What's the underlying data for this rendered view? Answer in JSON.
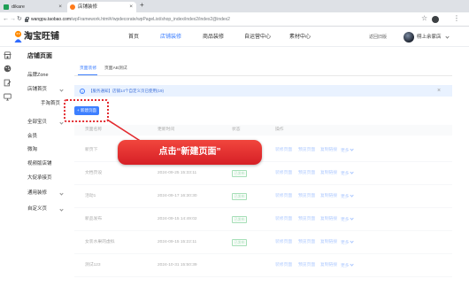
{
  "browser": {
    "tabs": [
      {
        "label": "dikare"
      },
      {
        "label": "店铺装修"
      }
    ],
    "url_domain": "wangpu.taobao.com",
    "url_path": "/wpFramework.html#/wpdecorate/wpPageList/shop_index/index2/index2@index2"
  },
  "header": {
    "logo_text": "淘宝旺铺",
    "nav": [
      {
        "label": "首页"
      },
      {
        "label": "店铺装修",
        "active": true
      },
      {
        "label": "商品装修"
      },
      {
        "label": "自运营中心"
      },
      {
        "label": "素材中心"
      }
    ],
    "back_to_old": "返回旧版",
    "shop_name": "栩上余家店"
  },
  "rail_icons": [
    "shop-icon",
    "palette-icon",
    "edit-document-icon",
    "monitor-icon"
  ],
  "sidebar": {
    "title": "店铺页面",
    "items": [
      {
        "label": "品牌Zone"
      },
      {
        "label": "店铺首页",
        "icon": "chevron-down-icon"
      },
      {
        "label": "手淘首页"
      },
      {
        "label": "全部宝贝",
        "icon": "chevron-down-icon"
      },
      {
        "label": "会员"
      },
      {
        "label": "微淘"
      },
      {
        "label": "视频版店铺"
      },
      {
        "label": "大促承接页"
      },
      {
        "label": "通用装修",
        "icon": "chevron-down-icon"
      },
      {
        "label": "自定义页",
        "icon": "chevron-down-icon"
      }
    ]
  },
  "main": {
    "tabs": [
      {
        "label": "页面装修",
        "active": true
      },
      {
        "label": "页面AB测试"
      }
    ],
    "notice": "【服务通知】店铺14个自定义页已使用(19)",
    "new_page_button": "+ 新建页面",
    "table": {
      "headers": [
        "页面名称",
        "更新时间",
        "状态",
        "操作"
      ],
      "rows": [
        {
          "name": "新页下"
        },
        {
          "name": "文档页设",
          "time": "2024-09-25 15:33:11",
          "status": "已发布"
        },
        {
          "name": "活动1",
          "time": "2024-09-17 16:30:30",
          "status": "已发布"
        },
        {
          "name": "新品发布",
          "time": "2024-09-15 14:49:02",
          "status": "已发布"
        },
        {
          "name": "女装水果的虚拟",
          "time": "2024-09-15 15:22:11",
          "status": "已发布"
        },
        {
          "name": "测试123",
          "time": "2024-10-31 15:50:39"
        }
      ],
      "actions": [
        "装修页面",
        "预览页面",
        "复制链接",
        "更多"
      ]
    }
  },
  "callout": {
    "text": "点击“新建页面”"
  },
  "colors": {
    "accent": "#3d7fff",
    "callout_red": "#e1262c",
    "status_green": "#2fb457",
    "notice_bg": "#e9f2ff"
  }
}
